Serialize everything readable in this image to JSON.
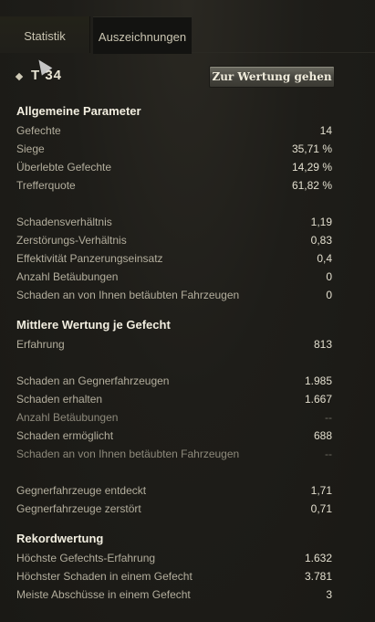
{
  "tabs": [
    {
      "label": "Statistik"
    },
    {
      "label": "Auszeichnungen"
    }
  ],
  "tank": {
    "name": "T 34"
  },
  "rating_button": "Zur Wertung gehen",
  "sections": {
    "general": {
      "title": "Allgemeine Parameter",
      "rows": [
        {
          "label": "Gefechte",
          "value": "14"
        },
        {
          "label": "Siege",
          "value": "35,71 %"
        },
        {
          "label": "Überlebte Gefechte",
          "value": "14,29 %"
        },
        {
          "label": "Trefferquote",
          "value": "61,82 %"
        },
        {
          "label": "Schadensverhältnis",
          "value": "1,19"
        },
        {
          "label": "Zerstörungs-Verhältnis",
          "value": "0,83"
        },
        {
          "label": "Effektivität Panzerungseinsatz",
          "value": "0,4"
        },
        {
          "label": "Anzahl Betäubungen",
          "value": "0"
        },
        {
          "label": "Schaden an von Ihnen betäubten Fahrzeugen",
          "value": "0"
        }
      ]
    },
    "average": {
      "title": "Mittlere Wertung je Gefecht",
      "rows": [
        {
          "label": "Erfahrung",
          "value": "813"
        },
        {
          "label": "Schaden an Gegnerfahrzeugen",
          "value": "1.985"
        },
        {
          "label": "Schaden erhalten",
          "value": "1.667"
        },
        {
          "label": "Anzahl Betäubungen",
          "value": "--"
        },
        {
          "label": "Schaden ermöglicht",
          "value": "688"
        },
        {
          "label": "Schaden an von Ihnen betäubten Fahrzeugen",
          "value": "--"
        },
        {
          "label": "Gegnerfahrzeuge entdeckt",
          "value": "1,71"
        },
        {
          "label": "Gegnerfahrzeuge zerstört",
          "value": "0,71"
        }
      ]
    },
    "record": {
      "title": "Rekordwertung",
      "rows": [
        {
          "label": "Höchste Gefechts-Erfahrung",
          "value": "1.632"
        },
        {
          "label": "Höchster Schaden in einem Gefecht",
          "value": "3.781"
        },
        {
          "label": "Meiste Abschüsse in einem Gefecht",
          "value": "3"
        }
      ]
    }
  }
}
